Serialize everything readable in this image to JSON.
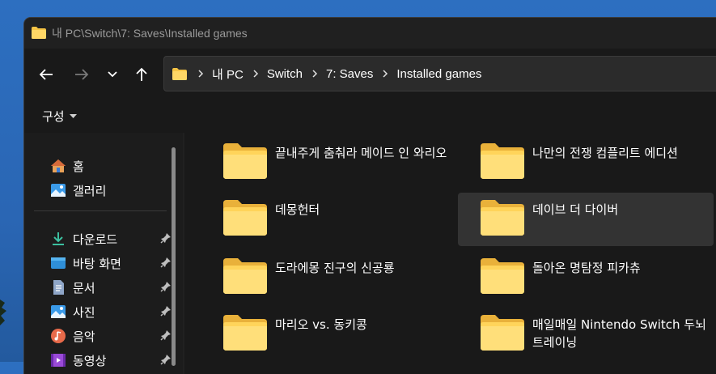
{
  "window": {
    "title": "내 PC\\Switch\\7: Saves\\Installed games"
  },
  "breadcrumbs": [
    "내 PC",
    "Switch",
    "7: Saves",
    "Installed games"
  ],
  "toolbar": {
    "layout_label": "구성"
  },
  "sidebar": {
    "items": [
      {
        "label": "홈",
        "icon": "home-icon"
      },
      {
        "label": "갤러리",
        "icon": "gallery-icon"
      },
      {
        "label": "다운로드",
        "icon": "download-icon",
        "pinned": true
      },
      {
        "label": "바탕 화면",
        "icon": "desktop-icon",
        "pinned": true
      },
      {
        "label": "문서",
        "icon": "document-icon",
        "pinned": true
      },
      {
        "label": "사진",
        "icon": "pictures-icon",
        "pinned": true
      },
      {
        "label": "음악",
        "icon": "music-icon",
        "pinned": true
      },
      {
        "label": "동영상",
        "icon": "video-icon",
        "pinned": true
      }
    ]
  },
  "folders": [
    {
      "name": "끝내주게 춤춰라 메이드 인 와리오"
    },
    {
      "name": "나만의 전쟁 컴플리트 에디션"
    },
    {
      "name": "데몽헌터"
    },
    {
      "name": "데이브 더 다이버",
      "selected": true
    },
    {
      "name": "도라에몽 진구의 신공룡"
    },
    {
      "name": "돌아온 명탐정 피카츄"
    },
    {
      "name": "마리오 vs. 동키콩"
    },
    {
      "name": "매일매일 Nintendo Switch 두뇌 트레이닝"
    }
  ],
  "colors": {
    "folder": "#f6c445",
    "window_bg": "#202020",
    "selection": "#333333"
  }
}
